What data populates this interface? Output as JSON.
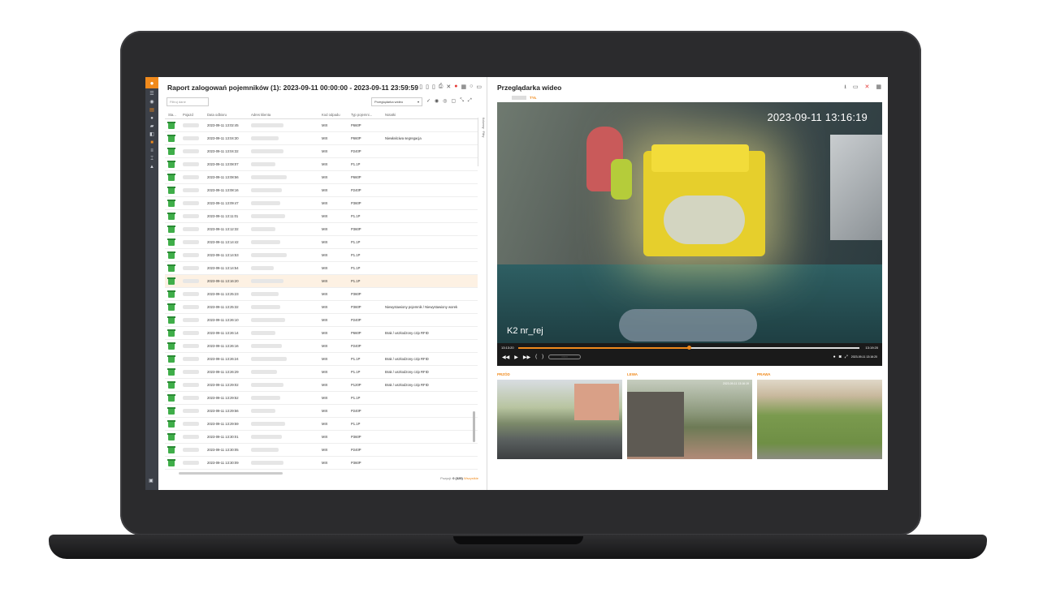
{
  "left_panel": {
    "title": "Raport zalogowań pojemników (1): 2023-09-11 00:00:00 - 2023-09-11 23:59:59",
    "filter_placeholder": "Filtruj dane",
    "view_select": "Przeglądarka wideo",
    "side_tabs": [
      "Kolumny",
      "Filtry"
    ],
    "columns": [
      "Sta...",
      "Pojazd",
      "Data odbioru",
      "Adres klienta",
      "Kod odpadu",
      "Typ pojemni...",
      "Notatki"
    ],
    "rows": [
      {
        "date": "2023-09-11 13:02:45",
        "code": "MIX",
        "type": "P660P",
        "note": ""
      },
      {
        "date": "2023-09-11 13:04:30",
        "code": "MIX",
        "type": "P660P",
        "note": "Niewłaściwa segregacja"
      },
      {
        "date": "2023-09-11 13:04:32",
        "code": "MIX",
        "type": "P240P",
        "note": ""
      },
      {
        "date": "2023-09-11 13:08:07",
        "code": "MIX",
        "type": "P1.1P",
        "note": ""
      },
      {
        "date": "2023-09-11 13:08:56",
        "code": "MIX",
        "type": "P660P",
        "note": ""
      },
      {
        "date": "2023-09-11 13:08:16",
        "code": "MIX",
        "type": "P240P",
        "note": ""
      },
      {
        "date": "2023-09-11 13:09:47",
        "code": "MIX",
        "type": "P360P",
        "note": ""
      },
      {
        "date": "2023-09-11 13:11:01",
        "code": "MIX",
        "type": "P1.1P",
        "note": ""
      },
      {
        "date": "2023-09-11 13:12:32",
        "code": "MIX",
        "type": "P360P",
        "note": ""
      },
      {
        "date": "2023-09-11 13:14:42",
        "code": "MIX",
        "type": "P1.1P",
        "note": ""
      },
      {
        "date": "2023-09-11 13:14:53",
        "code": "MIX",
        "type": "P1.1P",
        "note": ""
      },
      {
        "date": "2023-09-11 13:14:54",
        "code": "MIX",
        "type": "P1.1P",
        "note": ""
      },
      {
        "date": "2023-09-11 13:16:20",
        "code": "MIX",
        "type": "P1.1P",
        "note": ""
      },
      {
        "date": "2023-09-11 13:25:23",
        "code": "MIX",
        "type": "P360P",
        "note": ""
      },
      {
        "date": "2023-09-11 13:25:32",
        "code": "MIX",
        "type": "P360P",
        "note": "Niewystawiony pojemnik / Niewystawiony worek"
      },
      {
        "date": "2023-09-11 13:26:10",
        "code": "MIX",
        "type": "P240P",
        "note": ""
      },
      {
        "date": "2023-09-11 13:26:14",
        "code": "MIX",
        "type": "P660P",
        "note": "Brak / uszkodzony czip RFID"
      },
      {
        "date": "2023-09-11 13:26:16",
        "code": "MIX",
        "type": "P240P",
        "note": ""
      },
      {
        "date": "2023-09-11 13:26:24",
        "code": "MIX",
        "type": "P1.1P",
        "note": "Brak / uszkodzony czip RFID"
      },
      {
        "date": "2023-09-11 13:26:29",
        "code": "MIX",
        "type": "P1.1P",
        "note": "Brak / uszkodzony czip RFID"
      },
      {
        "date": "2023-09-11 13:29:02",
        "code": "MIX",
        "type": "P120P",
        "note": "Brak / uszkodzony czip RFID"
      },
      {
        "date": "2023-09-11 13:29:52",
        "code": "MIX",
        "type": "P1.1P",
        "note": ""
      },
      {
        "date": "2023-09-11 13:29:56",
        "code": "MIX",
        "type": "P240P",
        "note": ""
      },
      {
        "date": "2023-09-11 13:29:59",
        "code": "MIX",
        "type": "P1.1P",
        "note": ""
      },
      {
        "date": "2023-09-11 13:30:01",
        "code": "MIX",
        "type": "P360P",
        "note": ""
      },
      {
        "date": "2023-09-11 13:30:05",
        "code": "MIX",
        "type": "P240P",
        "note": ""
      },
      {
        "date": "2023-09-11 13:30:09",
        "code": "MIX",
        "type": "P360P",
        "note": ""
      }
    ],
    "selected_row": 12,
    "pager_label": "Pozycji",
    "pager_count": "0 (325)",
    "pager_extra": "Wszystkie"
  },
  "right_panel": {
    "title": "Przeglądarka wideo",
    "camera_label": "TYŁ",
    "video_timestamp": "2023-09-11 13:16:19",
    "video_overlay": "K2 nr_rej",
    "time_start": "13:13:20",
    "time_end": "13:19:20",
    "progress_fraction": 0.5,
    "controls_timestamp": "2023-09-11 13:16:20",
    "thumbs": [
      {
        "label": "PRZÓD"
      },
      {
        "label": "LEWA",
        "timestamp": "2023-09-11 13:16:19"
      },
      {
        "label": "PRAWA"
      }
    ]
  },
  "colors": {
    "accent": "#f08a1c",
    "bin_green": "#3fae49",
    "danger": "#e53935"
  },
  "icons": [
    "logo-icon",
    "list-icon",
    "globe-icon",
    "document-icon",
    "info-icon",
    "truck-icon",
    "layers-icon",
    "camera-icon",
    "menu-icon",
    "filter-icon",
    "user-icon",
    "settings-icon"
  ]
}
